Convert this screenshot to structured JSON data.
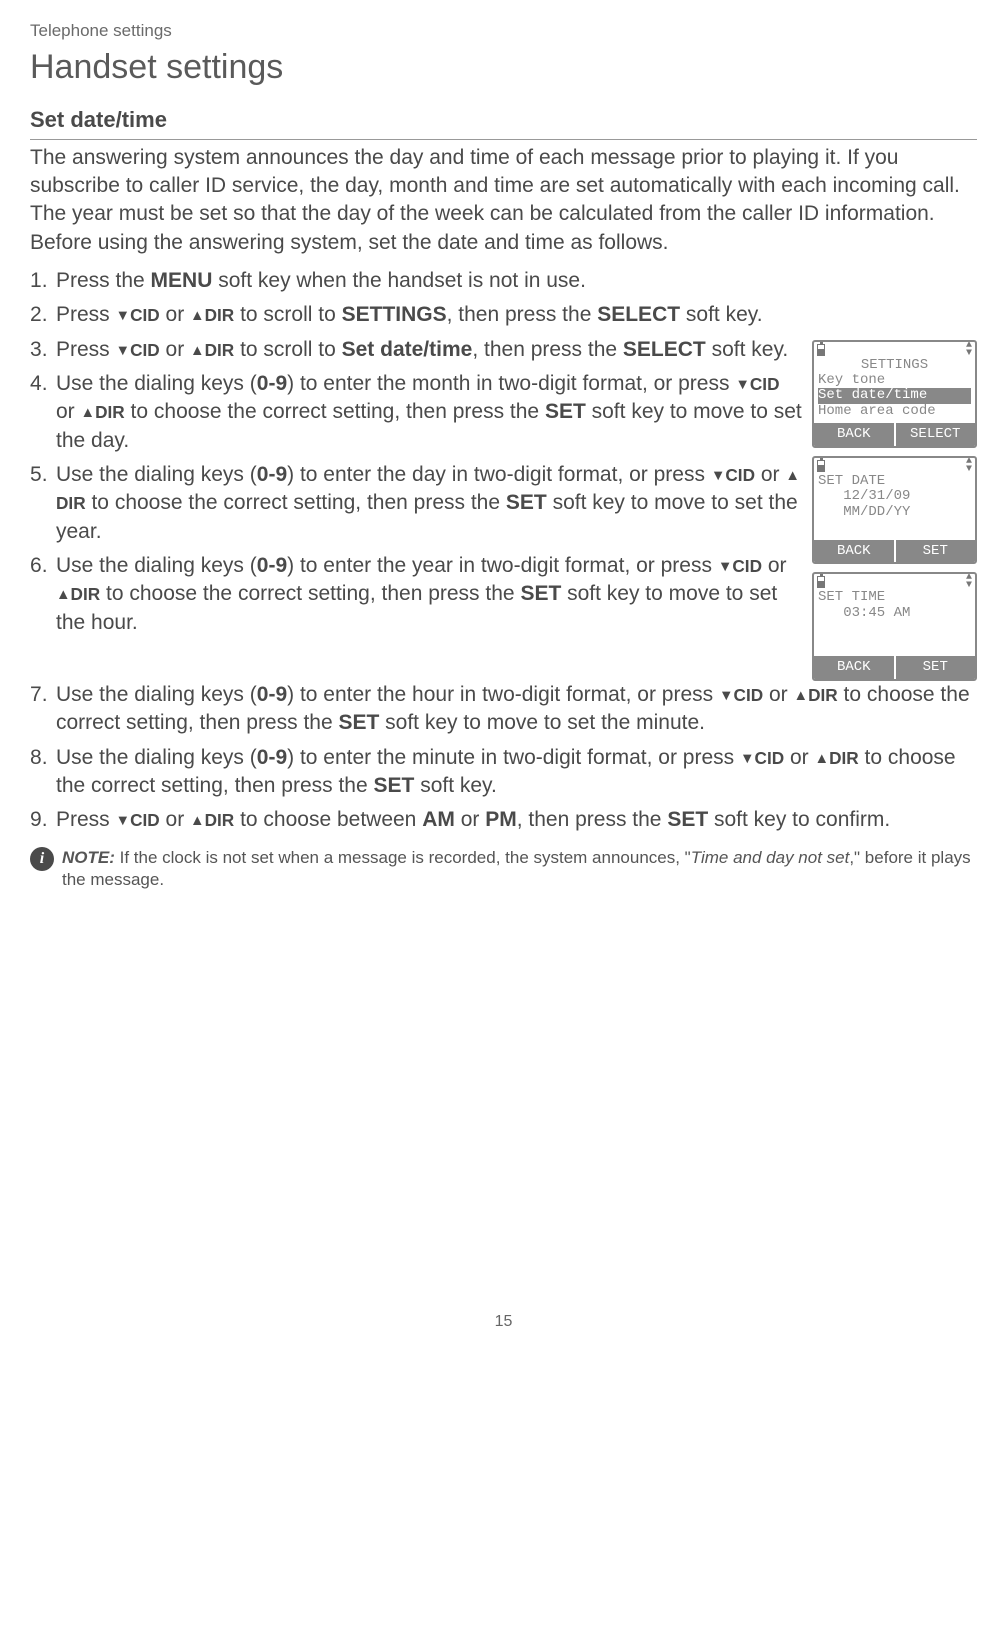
{
  "breadcrumb": "Telephone settings",
  "heading": "Handset settings",
  "subheading": "Set date/time",
  "intro": "The answering system announces the day and time of each message prior to playing it. If you subscribe to caller ID service, the day, month and time are set automatically with each incoming call. The year must be set so that the day of the week can be calculated from the caller ID information. Before using the answering system, set the date and time as follows.",
  "steps": {
    "s1_a": "Press the ",
    "s1_b": " soft key when the handset is not in use.",
    "s2_a": "Press ",
    "s2_b": " to scroll to ",
    "s2_c": ", then press the ",
    "s2_d": " soft key.",
    "s3_a": "Press ",
    "s3_b": " to scroll to ",
    "s3_c": ", then press the ",
    "s3_d": " soft key.",
    "s4_a": "Use the dialing keys (",
    "s4_b": ") to enter the month in two-digit format, or press ",
    "s4_c": " to choose the correct setting, then press the ",
    "s4_d": " soft key to move to set the day.",
    "s5_a": "Use the dialing keys (",
    "s5_b": ") to enter the day in two-digit format, or press ",
    "s5_c": " to choose the correct setting, then press the ",
    "s5_d": " soft key to move to set the year.",
    "s6_a": "Use the dialing keys (",
    "s6_b": ") to enter the year in two-digit format, or press ",
    "s6_c": " to choose the correct setting, then press the ",
    "s6_d": " soft key to move to set the hour.",
    "s7_a": "Use the dialing keys (",
    "s7_b": ") to enter the hour in two-digit format, or press ",
    "s7_c": " to choose the correct setting, then press the ",
    "s7_d": " soft key to move to set the minute.",
    "s8_a": "Use the dialing keys (",
    "s8_b": ") to enter the minute in two-digit format, or press ",
    "s8_c": " to choose the correct setting, then press the ",
    "s8_d": " soft key.",
    "s9_a": "Press ",
    "s9_b": " to choose between ",
    "s9_c": ", then press the ",
    "s9_d": " soft key to confirm."
  },
  "keys": {
    "menu": "MENU",
    "cid": "CID",
    "dir": "DIR",
    "settings": "SETTINGS",
    "select": "SELECT",
    "setdatetime": "Set date/time",
    "digits": "0-9",
    "set": "SET",
    "am": "AM",
    "pm": "PM",
    "or": " or ",
    "ortxt": " or "
  },
  "note": {
    "label": "NOTE:",
    "text_a": " If the clock is not set when a message is recorded, the system announces, \"",
    "text_quote": "Time and day not set",
    "text_b": ",\" before it plays the message."
  },
  "screens": {
    "s1": {
      "title": "SETTINGS",
      "l1": "Key tone",
      "l2": "Set date/time",
      "l3": "Home area code",
      "sk1": "BACK",
      "sk2": "SELECT"
    },
    "s2": {
      "title": "SET DATE",
      "l1": "   12/31/09",
      "l2": "   MM/DD/YY",
      "sk1": "BACK",
      "sk2": "SET"
    },
    "s3": {
      "title": "SET TIME",
      "l1": "   03:45 AM",
      "sk1": "BACK",
      "sk2": "SET"
    }
  },
  "page_number": "15"
}
